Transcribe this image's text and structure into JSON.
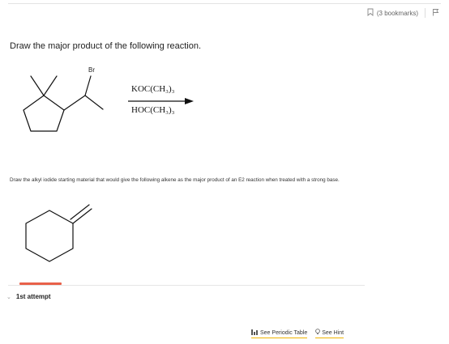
{
  "header": {
    "bookmarks_label": "(3 bookmarks)"
  },
  "question": {
    "prompt": "Draw the major product of the following reaction.",
    "substituent_label": "Br",
    "reagent_top": "KOC(CH₃)₃",
    "reagent_bottom": "HOC(CH₃)₃"
  },
  "second_question": {
    "text": "Draw the alkyl iodide starting material that would give the following alkene as the major product of an E2 reaction when treated with a strong base."
  },
  "attempt": {
    "label": "1st attempt"
  },
  "footer": {
    "periodic_table": "See Periodic Table",
    "hint": "See Hint"
  },
  "colors": {
    "attempt_accent": "#e8614a",
    "link_underline": "#f0b400"
  }
}
